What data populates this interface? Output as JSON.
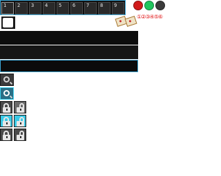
{
  "hotbar": {
    "slots": [
      "1",
      "2",
      "3",
      "4",
      "5",
      "6",
      "7",
      "8",
      "9"
    ],
    "selected_index": 0
  },
  "status": {
    "dot_colors": [
      "#d11a1a",
      "#21c55d",
      "#3b3b3b"
    ],
    "glyphs": "①②③④⑤⑥"
  },
  "icons": {
    "papers": [
      "map-paper-icon",
      "map-paper-icon"
    ],
    "cursor": "white-square-cursor-icon",
    "search": "magnifier-icon",
    "locks": [
      "lock-closed-icon",
      "lock-open-icon"
    ]
  }
}
